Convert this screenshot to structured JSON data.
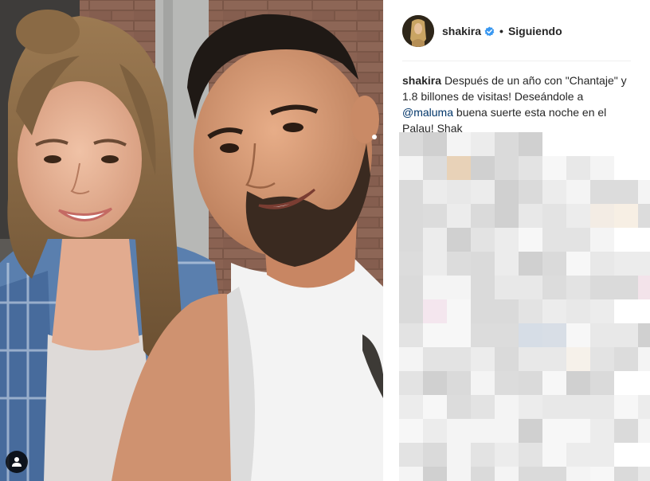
{
  "post": {
    "username": "shakira",
    "follow_status": "Siguiendo",
    "separator": "•"
  },
  "caption": {
    "username": "shakira",
    "text_before": "Después de un año con \"Chantaje\" y 1.8 billones de visitas! Deseándole a",
    "mention": "@maluma",
    "text_after": "buena suerte esta noche en el Palau! Shak"
  },
  "icons": {
    "verified": "verified-badge-icon",
    "user_tag": "user-tag-icon"
  },
  "colors": {
    "verified_blue": "#3897f0",
    "mention_link": "#003569",
    "text": "#262626"
  }
}
